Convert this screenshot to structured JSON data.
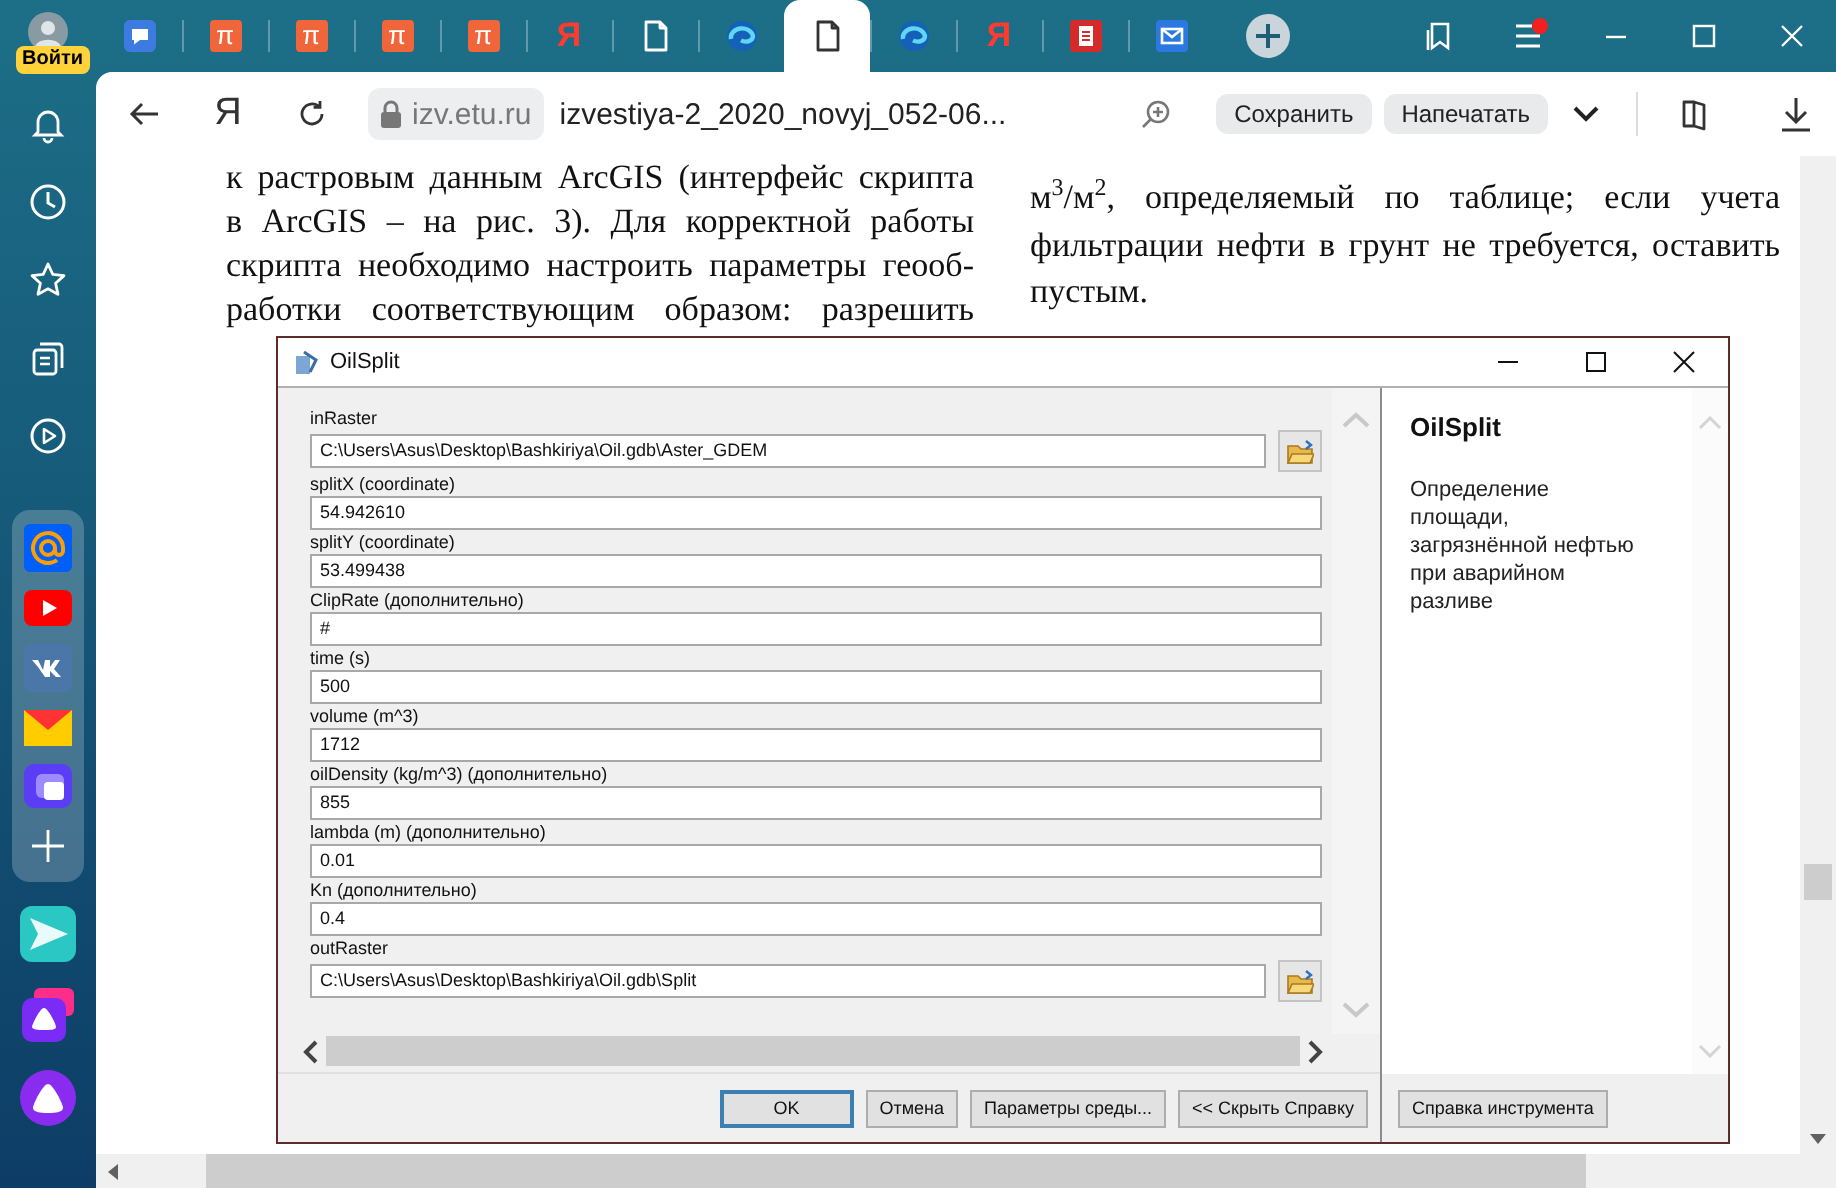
{
  "browser": {
    "profile": {
      "label": "Войти"
    },
    "tabs": [
      {
        "kind": "chat",
        "selected": false
      },
      {
        "kind": "pi",
        "label": "π",
        "selected": false
      },
      {
        "kind": "pi",
        "label": "π",
        "selected": false
      },
      {
        "kind": "pi",
        "label": "π",
        "selected": false
      },
      {
        "kind": "pi",
        "label": "π",
        "selected": false
      },
      {
        "kind": "yandex",
        "label": "Я",
        "selected": false
      },
      {
        "kind": "doc",
        "selected": false
      },
      {
        "kind": "swirl",
        "selected": false
      },
      {
        "kind": "doc",
        "selected": true
      },
      {
        "kind": "swirl",
        "selected": false
      },
      {
        "kind": "yandex",
        "label": "Я",
        "selected": false
      },
      {
        "kind": "reader",
        "selected": false
      },
      {
        "kind": "mail",
        "selected": false
      }
    ],
    "menu": {
      "notification": true
    },
    "toolbar": {
      "home_label": "Я",
      "domain": "izv.etu.ru",
      "title": "izvestiya-2_2020_novyj_052-06...",
      "buttons": [
        "Сохранить",
        "Напечатать"
      ]
    },
    "sidebar": {
      "nav": [
        {
          "kind": "bell"
        },
        {
          "kind": "clock"
        },
        {
          "kind": "star"
        },
        {
          "kind": "collections"
        },
        {
          "kind": "play"
        }
      ],
      "apps": [
        {
          "kind": "at"
        },
        {
          "kind": "video"
        },
        {
          "kind": "vk"
        },
        {
          "kind": "envelope"
        },
        {
          "kind": "windows"
        },
        {
          "kind": "add"
        }
      ],
      "extra": [
        {
          "kind": "send"
        },
        {
          "kind": "alice-square"
        },
        {
          "kind": "alice-circle"
        }
      ]
    }
  },
  "article": {
    "columns": [
      {
        "lines": [
          "к растровым данным ArcGIS (интерфейс скрипта",
          "в ArcGIS – на рис. 3). Для корректной работы",
          "скрипта необходимо настроить параметры геооб-",
          "работки соответствующим образом: разрешить"
        ]
      },
      {
        "lines": [
          "м$^{3}$/м$^{2}$, определяемый по таблице; если учета",
          "фильтрации нефти в грунт не требуется, оставить",
          "пустым."
        ]
      }
    ]
  },
  "dialog": {
    "title": "OilSplit",
    "parameters": [
      {
        "label": "inRaster",
        "value": "C:\\Users\\Asus\\Desktop\\Bashkiriya\\Oil.gdb\\Aster_GDEM",
        "browse": true
      },
      {
        "label": "splitX (coordinate)",
        "value": "54.942610",
        "browse": false
      },
      {
        "label": "splitY (coordinate)",
        "value": "53.499438",
        "browse": false
      },
      {
        "label": "ClipRate (дополнительно)",
        "value": "#",
        "browse": false
      },
      {
        "label": "time (s)",
        "value": "500",
        "browse": false
      },
      {
        "label": "volume (m^3)",
        "value": "1712",
        "browse": false
      },
      {
        "label": "oilDensity (kg/m^3) (дополнительно)",
        "value": "855",
        "browse": false
      },
      {
        "label": "lambda (m) (дополнительно)",
        "value": "0.01",
        "browse": false
      },
      {
        "label": "Kn (дополнительно)",
        "value": "0.4",
        "browse": false
      },
      {
        "label": "outRaster",
        "value": "C:\\Users\\Asus\\Desktop\\Bashkiriya\\Oil.gdb\\Split",
        "browse": true
      }
    ],
    "help": {
      "title": "OilSplit",
      "description": "Определение площади, загрязнённой нефтью при аварийном разливе"
    },
    "buttons": [
      {
        "label": "OK",
        "default": true
      },
      {
        "label": "Отмена",
        "default": false
      },
      {
        "label": "Параметры среды...",
        "default": false
      },
      {
        "label": "<< Скрыть Справку",
        "default": false
      }
    ],
    "help_button": "Справка инструмента"
  }
}
